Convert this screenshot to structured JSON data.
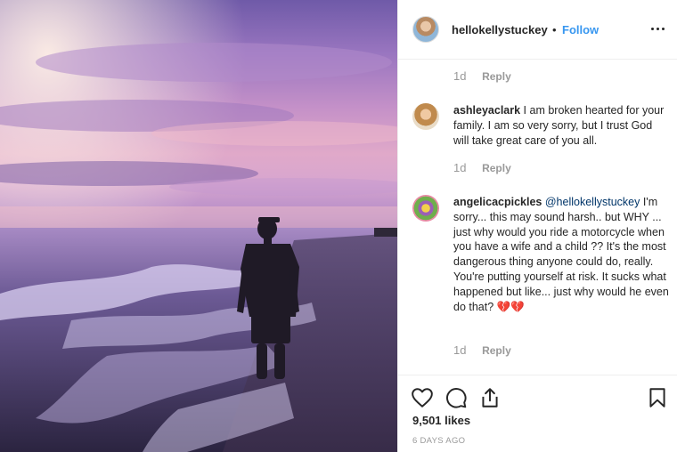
{
  "header": {
    "username": "hellokellystuckey",
    "separator": "•",
    "follow_label": "Follow",
    "more_icon": "more-options-icon"
  },
  "comments": [
    {
      "time": "1d",
      "reply_label": "Reply"
    },
    {
      "username": "ashleyaclark",
      "text": "I am broken hearted for your family. I am so very sorry, but I trust God will take great care of you all.",
      "time": "1d",
      "reply_label": "Reply"
    },
    {
      "username": "angelicacpickles",
      "mention": "@hellokellystuckey",
      "text": "I'm sorry... this may sound harsh.. but WHY ... just why would you ride a motorcycle when you have a wife and a child ?? It's the most dangerous thing anyone could do, really. You're putting yourself at risk. It sucks what happened but like... just why would he even do that? 💔💔",
      "time": "1d",
      "reply_label": "Reply"
    }
  ],
  "actions": {
    "like_icon": "heart-icon",
    "comment_icon": "comment-icon",
    "share_icon": "share-icon",
    "save_icon": "bookmark-icon"
  },
  "likes_text": "9,501 likes",
  "date_text": "6 DAYS AGO",
  "colors": {
    "link": "#3897f0",
    "mention": "#003569",
    "muted": "#999999",
    "border": "#efefef"
  }
}
